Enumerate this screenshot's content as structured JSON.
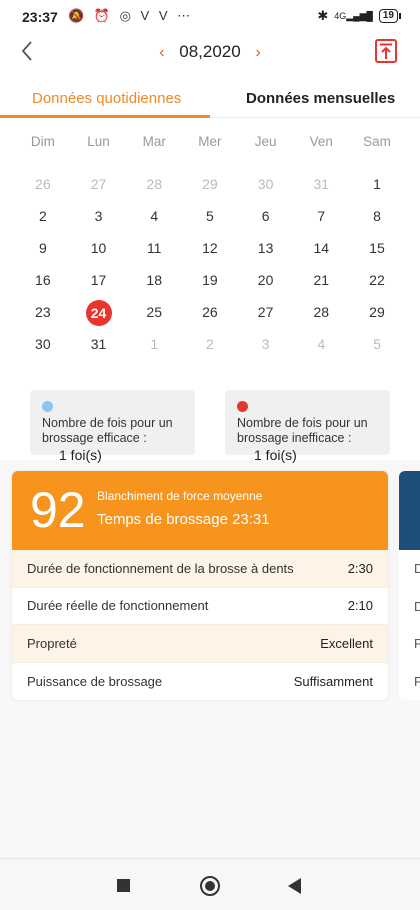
{
  "status": {
    "time": "23:37",
    "left_icons": [
      "mute-icon",
      "alarm-icon",
      "app-icon",
      "v-icon",
      "v-icon",
      "more-icon"
    ],
    "left_glyphs": "🔕 ⏰ ◎ V V ⋯",
    "network": "4G",
    "battery": "19"
  },
  "header": {
    "month": "08,2020",
    "prev_icon": "chevron-left-icon",
    "next_icon": "chevron-right-icon",
    "export_icon": "export-icon"
  },
  "tabs": {
    "daily": "Données quotidiennes",
    "monthly": "Données mensuelles"
  },
  "calendar": {
    "weekdays": [
      "Dim",
      "Lun",
      "Mar",
      "Mer",
      "Jeu",
      "Ven",
      "Sam"
    ],
    "weeks": [
      [
        {
          "d": "26",
          "other": true
        },
        {
          "d": "27",
          "other": true
        },
        {
          "d": "28",
          "other": true
        },
        {
          "d": "29",
          "other": true
        },
        {
          "d": "30",
          "other": true
        },
        {
          "d": "31",
          "other": true
        },
        {
          "d": "1"
        }
      ],
      [
        {
          "d": "2"
        },
        {
          "d": "3"
        },
        {
          "d": "4"
        },
        {
          "d": "5"
        },
        {
          "d": "6"
        },
        {
          "d": "7"
        },
        {
          "d": "8"
        }
      ],
      [
        {
          "d": "9"
        },
        {
          "d": "10"
        },
        {
          "d": "11"
        },
        {
          "d": "12"
        },
        {
          "d": "13"
        },
        {
          "d": "14"
        },
        {
          "d": "15"
        }
      ],
      [
        {
          "d": "16"
        },
        {
          "d": "17"
        },
        {
          "d": "18"
        },
        {
          "d": "19"
        },
        {
          "d": "20"
        },
        {
          "d": "21"
        },
        {
          "d": "22"
        }
      ],
      [
        {
          "d": "23"
        },
        {
          "d": "24",
          "selected": true
        },
        {
          "d": "25"
        },
        {
          "d": "26"
        },
        {
          "d": "27"
        },
        {
          "d": "28"
        },
        {
          "d": "29"
        }
      ],
      [
        {
          "d": "30"
        },
        {
          "d": "31"
        },
        {
          "d": "1",
          "other": true
        },
        {
          "d": "2",
          "other": true
        },
        {
          "d": "3",
          "other": true
        },
        {
          "d": "4",
          "other": true
        },
        {
          "d": "5",
          "other": true
        }
      ]
    ]
  },
  "legend": {
    "effective": {
      "label": "Nombre de fois pour un brossage efficace :",
      "value": "1 foi(s)",
      "color": "#8cc4f2"
    },
    "ineffective": {
      "label": "Nombre de fois pour un brossage inefficace :",
      "value": "1 foi(s)",
      "color": "#e8352e"
    }
  },
  "card": {
    "score": "92",
    "mode": "Blanchiment de force moyenne",
    "brush_time": "Temps de brossage 23:31",
    "accent": "#f7941d",
    "rows": [
      {
        "label": "Durée de fonctionnement de la brosse à dents",
        "value": "2:30"
      },
      {
        "label": "Durée réelle de fonctionnement",
        "value": "2:10"
      },
      {
        "label": "Propreté",
        "value": "Excellent"
      },
      {
        "label": "Puissance de brossage",
        "value": "Suffisamment"
      }
    ]
  },
  "peek_card": {
    "accent": "#1e4f7a",
    "rows": [
      "D",
      "D",
      "P",
      "P"
    ]
  }
}
